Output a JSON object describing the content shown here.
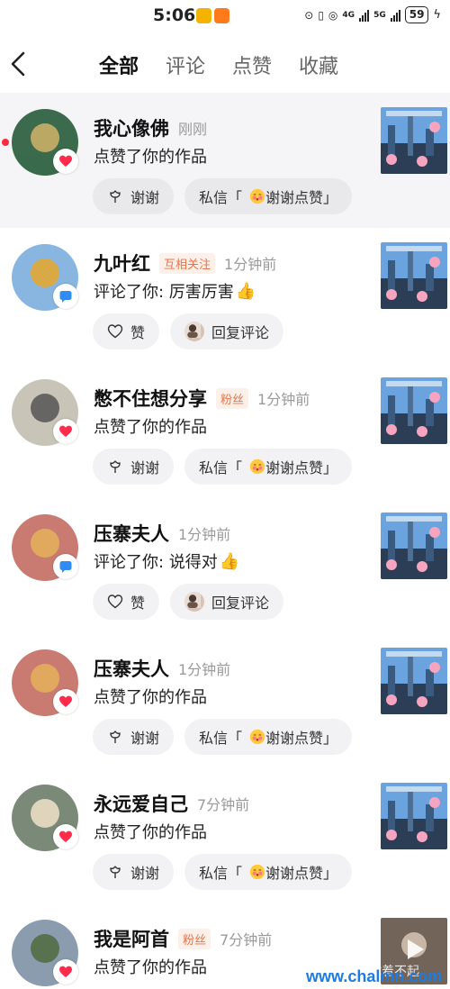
{
  "status_bar": {
    "time": "5:06",
    "network_1": "4G",
    "network_2": "5G",
    "battery": "59"
  },
  "header": {
    "tabs": [
      {
        "label": "全部",
        "active": true
      },
      {
        "label": "评论",
        "active": false
      },
      {
        "label": "点赞",
        "active": false
      },
      {
        "label": "收藏",
        "active": false
      }
    ]
  },
  "notifications": [
    {
      "name": "我心像佛",
      "tag": "",
      "time": "刚刚",
      "content": "点赞了你的作品",
      "thumbs_up": false,
      "type": "like",
      "action1": "谢谢",
      "action2_prefix": "私信「",
      "action2_text": "谢谢点赞",
      "action2_suffix": "」",
      "unread": true
    },
    {
      "name": "九叶红",
      "tag": "互相关注",
      "time": "1分钟前",
      "content": "评论了你: 厉害厉害",
      "thumbs_up": true,
      "type": "comment",
      "action1": "赞",
      "action2_text": "回复评论",
      "unread": false
    },
    {
      "name": "憋不住想分享",
      "tag": "粉丝",
      "time": "1分钟前",
      "content": "点赞了你的作品",
      "thumbs_up": false,
      "type": "like",
      "action1": "谢谢",
      "action2_prefix": "私信「",
      "action2_text": "谢谢点赞",
      "action2_suffix": "」",
      "unread": false
    },
    {
      "name": "压寨夫人",
      "tag": "",
      "time": "1分钟前",
      "content": "评论了你: 说得对",
      "thumbs_up": true,
      "type": "comment",
      "action1": "赞",
      "action2_text": "回复评论",
      "unread": false
    },
    {
      "name": "压寨夫人",
      "tag": "",
      "time": "1分钟前",
      "content": "点赞了你的作品",
      "thumbs_up": false,
      "type": "like",
      "action1": "谢谢",
      "action2_prefix": "私信「",
      "action2_text": "谢谢点赞",
      "action2_suffix": "」",
      "unread": false
    },
    {
      "name": "永远爱自己",
      "tag": "",
      "time": "7分钟前",
      "content": "点赞了你的作品",
      "thumbs_up": false,
      "type": "like",
      "action1": "谢谢",
      "action2_prefix": "私信「",
      "action2_text": "谢谢点赞",
      "action2_suffix": "」",
      "unread": false
    },
    {
      "name": "我是阿首",
      "tag": "粉丝",
      "time": "7分钟前",
      "content": "点赞了你的作品",
      "thumbs_up": false,
      "type": "like",
      "unread": false
    }
  ],
  "watermark": "www.chalmn.com",
  "watermark_overlay": "好你着不起",
  "colors": {
    "like_red": "#ff2b4a",
    "comment_blue": "#2f8bf5",
    "tag_orange": "#e8734a",
    "highlight_bg": "#f5f5f7"
  }
}
